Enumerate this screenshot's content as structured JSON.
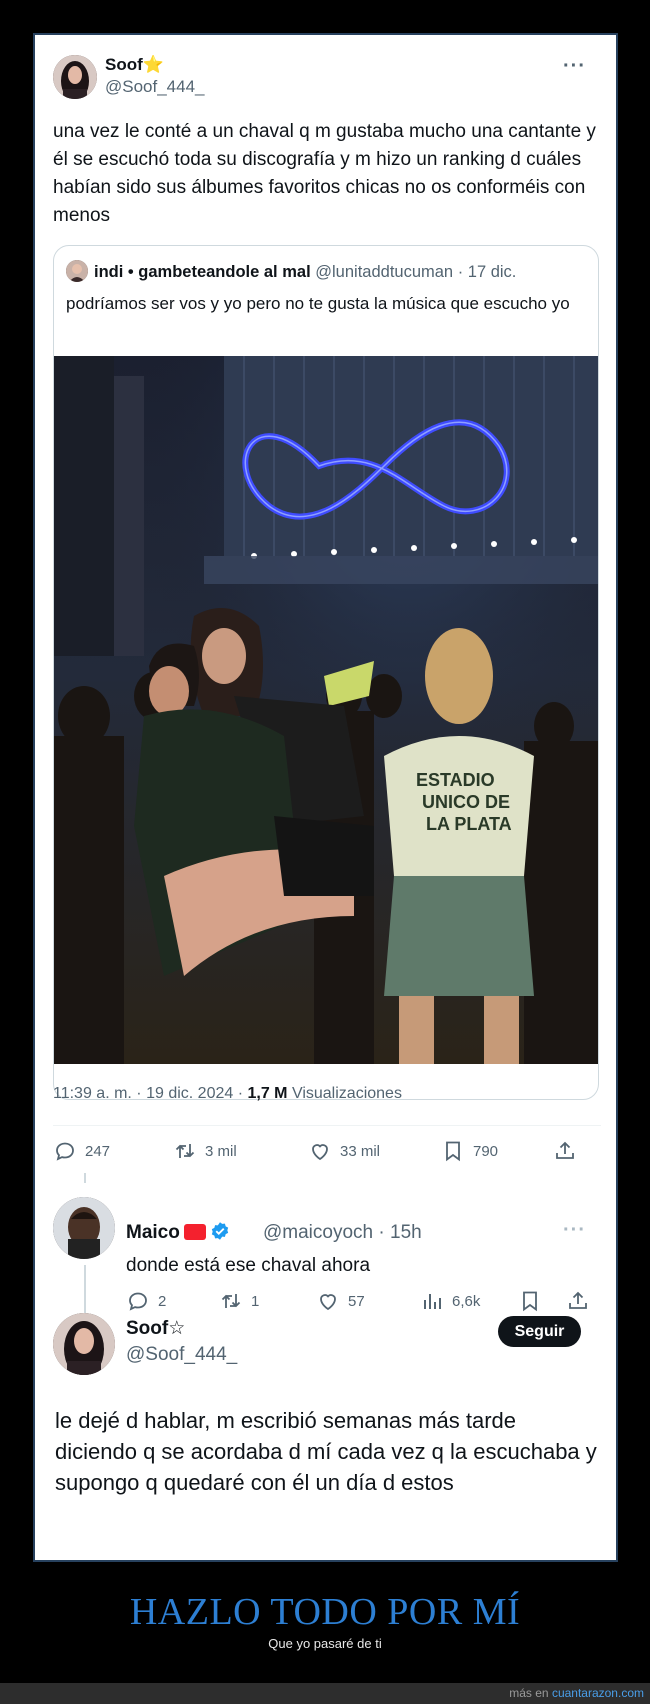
{
  "main_tweet": {
    "author_name": "Soof⭐",
    "author_handle": "@Soof_444_",
    "more_icon": "more-dots",
    "text": "una vez le conté a un chaval q m gustaba mucho una cantante y él se escuchó toda su discografía y m hizo un ranking d cuáles habían sido sus álbumes favoritos chicas no os conforméis con menos",
    "quote": {
      "author_name": "indi • gambeteandole al mal",
      "author_handle": "@lunitaddtucuman",
      "time": "· 17 dic.",
      "text": "podríamos ser vos y yo pero no te gusta la música que escucho yo",
      "photo_shirt_text": [
        "ESTADIO",
        "UNICO DE",
        "LA PLATA"
      ]
    },
    "time_date": "11:39 a. m. · 19 dic. 2024 · ",
    "views_count": "1,7 M",
    "views_label": " Visualizaciones",
    "stats": {
      "replies": "247",
      "retweets": "3 mil",
      "likes": "33 mil",
      "bookmarks": "790"
    }
  },
  "reply": {
    "author_name": "Maico",
    "author_handle": "@maicoyoch",
    "time": "· 15h",
    "text": "donde está ese chaval ahora",
    "stats": {
      "replies": "2",
      "retweets": "1",
      "likes": "57",
      "views": "6,6k"
    }
  },
  "response": {
    "author_name": "Soof☆",
    "author_handle": "@Soof_444_",
    "follow_label": "Seguir",
    "text": "le dejé d hablar, m escribió semanas más tarde diciendo q se acordaba d mí cada vez q la escuchaba y supongo q quedaré con él un día d estos"
  },
  "caption": {
    "title": "HAZLO TODO POR MÍ",
    "subtitle": "Que yo pasaré de ti"
  },
  "footer": {
    "prefix": "más en ",
    "site": "cuantarazon.com"
  },
  "colors": {
    "accent_blue": "#1d9bf0",
    "caption_blue": "#2d7fd3",
    "text_primary": "#0f1419",
    "text_secondary": "#536471"
  }
}
